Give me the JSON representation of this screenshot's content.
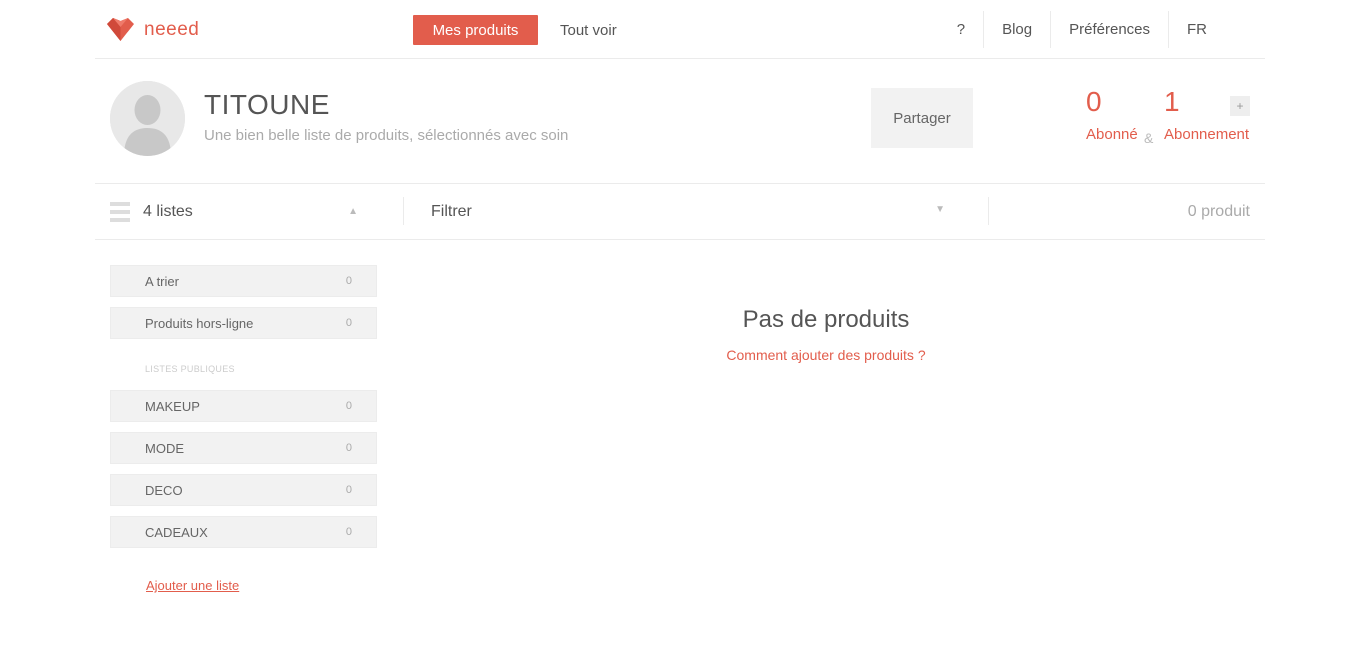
{
  "brand": {
    "name": "neeed",
    "color": "#e25d4c",
    "icon": "heart-gem-icon"
  },
  "nav": {
    "primary_tab": "Mes produits",
    "secondary_tab": "Tout voir",
    "help": "?",
    "blog": "Blog",
    "preferences": "Préférences",
    "language": "FR"
  },
  "profile": {
    "name": "TITOUNE",
    "description": "Une bien belle liste de produits, sélectionnés avec soin",
    "share_label": "Partager",
    "followers_count": "0",
    "followers_label": "Abonné",
    "ampersand": "&",
    "following_count": "1",
    "following_label": "Abonnement",
    "plus_label": "+"
  },
  "filterbar": {
    "lists_label": "4 listes",
    "filter_label": "Filtrer",
    "product_count": "0 produit"
  },
  "sidebar": {
    "private_lists": [
      {
        "label": "A trier",
        "count": "0"
      },
      {
        "label": "Produits hors-ligne",
        "count": "0"
      }
    ],
    "public_header": "LISTES PUBLIQUES",
    "public_lists": [
      {
        "label": "MAKEUP",
        "count": "0"
      },
      {
        "label": "MODE",
        "count": "0"
      },
      {
        "label": "DECO",
        "count": "0"
      },
      {
        "label": "CADEAUX",
        "count": "0"
      }
    ],
    "add_list": "Ajouter une liste"
  },
  "empty_state": {
    "title": "Pas de produits",
    "help_link": "Comment ajouter des produits ?"
  }
}
